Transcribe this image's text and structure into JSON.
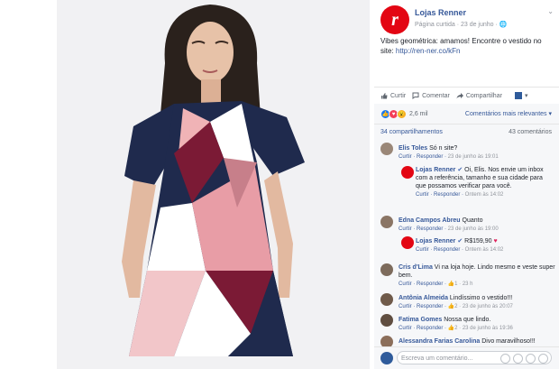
{
  "post": {
    "page_name": "Lojas Renner",
    "page_meta": "Página curtida · 23 de junho · ",
    "logo_letter": "r",
    "text": "Vibes geométrica: amamos! Encontre o vestido no site: ",
    "link": "http://ren-ner.co/kFn",
    "brand_color": "#e30613",
    "link_color": "#365899"
  },
  "actions": {
    "like": "Curtir",
    "comment": "Comentar",
    "share": "Compartilhar"
  },
  "reactions": {
    "count": "2,6 mil",
    "relevance": "Comentários mais relevantes ▾"
  },
  "counts": {
    "shares": "34 compartilhamentos",
    "comments": "43 comentários"
  },
  "comments": [
    {
      "name": "Elis Toles",
      "text": "Só n site?",
      "meta_links": "Curtir · Responder ·",
      "meta_time": " 23 de junho às 19:01"
    },
    {
      "name": "Lojas Renner",
      "text": "Oi, Elis. Nos envie um inbox com a referência, tamanho e sua cidade para que possamos verificar para você.",
      "meta_links": "Curtir · Responder ·",
      "meta_time": " Ontem às 14:02"
    },
    {
      "name": "Edna Campos Abreu",
      "text": "Quanto",
      "meta_links": "Curtir · Responder ·",
      "meta_time": " 23 de junho às 19:00"
    },
    {
      "name": "Lojas Renner",
      "text": "R$159,90",
      "meta_links": "Curtir · Responder ·",
      "meta_time": " Ontem às 14:02"
    },
    {
      "name": "Cris d'Lima",
      "text": "Vi na loja hoje. Lindo mesmo e veste super bem.",
      "meta_links": "Curtir · Responder · ",
      "meta_time": "1 · 23 h"
    },
    {
      "name": "Antônia Almeida",
      "text": "Lindíssimo o vestido!!!",
      "meta_links": "Curtir · Responder · ",
      "meta_time": "2 · 23 de junho às 20:07"
    },
    {
      "name": "Fatima Gomes",
      "text": "Nossa que lindo.",
      "meta_links": "Curtir · Responder · ",
      "meta_time": "2 · 23 de junho às 19:36"
    },
    {
      "name": "Alessandra Farias Carolina",
      "text": "Divo maravilhoso!!!",
      "meta_links": "",
      "meta_time": ""
    }
  ],
  "composer": {
    "placeholder": "Escreva um comentário..."
  }
}
